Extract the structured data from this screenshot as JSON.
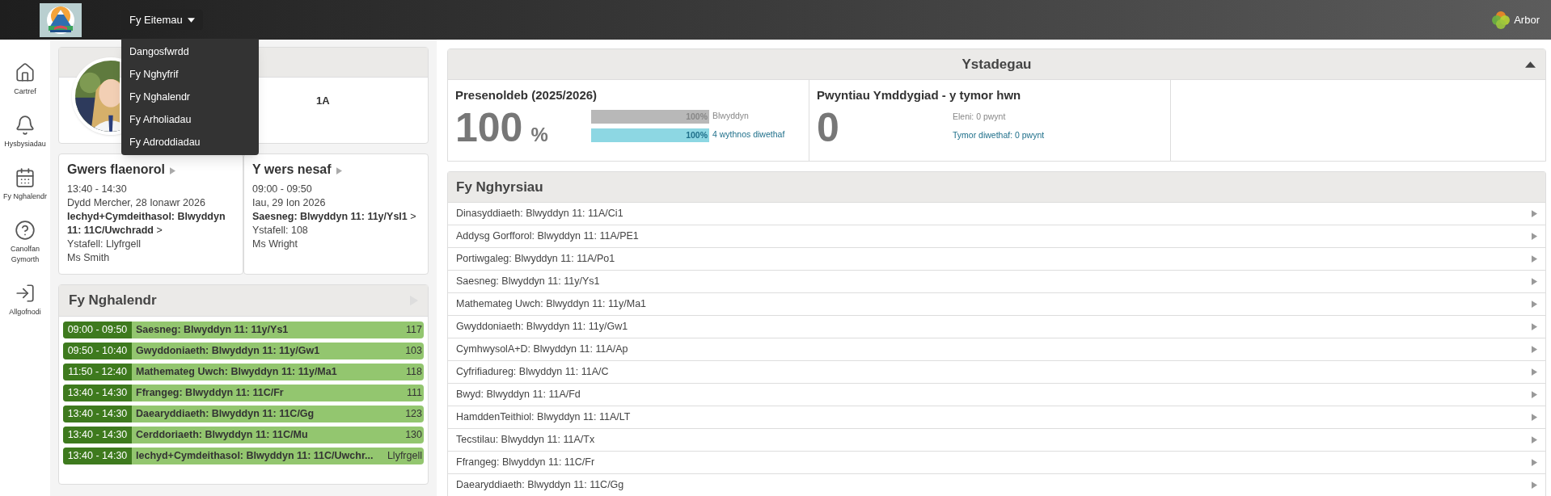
{
  "header": {
    "menu_label": "Fy Eitemau",
    "brand": "Arbor"
  },
  "dropdown": [
    "Dangosfwrdd",
    "Fy Nghyfrif",
    "Fy Nghalendr",
    "Fy Arholiadau",
    "Fy Adroddiadau"
  ],
  "sidebar": [
    {
      "kind": "home",
      "label": "Cartref"
    },
    {
      "kind": "bell",
      "label": "Hysbysiadau"
    },
    {
      "kind": "calendar",
      "label": "Fy Nghalendr"
    },
    {
      "kind": "help",
      "label": "Canolfan Gymorth"
    },
    {
      "kind": "logout",
      "label": "Allgofnodi"
    }
  ],
  "profile": {
    "text": "1A"
  },
  "lessons": [
    {
      "title": "Gwers flaenorol",
      "time": "13:40 - 14:30",
      "date": "Dydd Mercher, 28 Ionawr 2026",
      "class": "**Iechyd+Cymdeithasol: Blwyddyn 11: 11C/Uwchradd** >",
      "room": "Ystafell: Llyfrgell",
      "teacher": "Ms Smith"
    },
    {
      "title": "Y wers nesaf",
      "time": "09:00 - 09:50",
      "date": "Iau, 29 Ion 2026",
      "class": "**Saesneg: Blwyddyn 11: 11y/Ysl1** >",
      "room": "Ystafell: 108",
      "teacher": "Ms Wright"
    }
  ],
  "calendar": {
    "title": "Fy Nghalendr",
    "events": [
      {
        "time": "09:00 - 09:50",
        "title": "Saesneg: Blwyddyn 11: 11y/Ys1",
        "room": "117"
      },
      {
        "time": "09:50 - 10:40",
        "title": "Gwyddoniaeth: Blwyddyn 11: 11y/Gw1",
        "room": "103"
      },
      {
        "time": "11:50 - 12:40",
        "title": "Mathemateg Uwch: Blwyddyn 11: 11y/Ma1",
        "room": "118"
      },
      {
        "time": "13:40 - 14:30",
        "title": "Ffrangeg: Blwyddyn 11: 11C/Fr",
        "room": "111"
      },
      {
        "time": "13:40 - 14:30",
        "title": "Daearyddiaeth: Blwyddyn 11: 11C/Gg",
        "room": "123"
      },
      {
        "time": "13:40 - 14:30",
        "title": "Cerddoriaeth: Blwyddyn 11: 11C/Mu",
        "room": "130"
      },
      {
        "time": "13:40 - 14:30",
        "title": "Iechyd+Cymdeithasol: Blwyddyn 11: 11C/Uwchr...",
        "room": "Llyfrgell"
      }
    ]
  },
  "statistics": {
    "title": "Ystadegau",
    "attendance": {
      "title": "Presenoldeb (2025/2026)",
      "value": "100",
      "unit": "%",
      "bars": [
        {
          "kind": "year",
          "percent": "100%",
          "label": "Blwyddyn",
          "level": 1
        },
        {
          "kind": "recent",
          "percent": "100%",
          "label": "4 wythnos diwethaf",
          "level": 1
        }
      ]
    },
    "behaviour": {
      "title": "Pwyntiau Ymddygiad - y tymor hwn",
      "value": "0",
      "lines": [
        {
          "kind": "plain",
          "text": "Eleni: 0 pwynt"
        },
        {
          "kind": "link",
          "text": "Tymor diwethaf: 0 pwynt"
        }
      ]
    }
  },
  "courses": {
    "title": "Fy Nghyrsiau",
    "items": [
      "Dinasyddiaeth: Blwyddyn 11: 11A/Ci1",
      "Addysg Gorfforol: Blwyddyn 11: 11A/PE1",
      "Portiwgaleg: Blwyddyn 11: 11A/Po1",
      "Saesneg: Blwyddyn 11: 11y/Ys1",
      "Mathemateg Uwch: Blwyddyn 11: 11y/Ma1",
      "Gwyddoniaeth: Blwyddyn 11: 11y/Gw1",
      "CymhwysolA+D: Blwyddyn 11: 11A/Ap",
      "Cyfrifiadureg: Blwyddyn 11: 11A/C",
      "Bwyd: Blwyddyn 11: 11A/Fd",
      "HamddenTeithiol: Blwyddyn 11: 11A/LT",
      "Tecstilau: Blwyddyn 11: 11A/Tx",
      "Ffrangeg: Blwyddyn 11: 11C/Fr",
      "Daearyddiaeth: Blwyddyn 11: 11C/Gg"
    ]
  }
}
